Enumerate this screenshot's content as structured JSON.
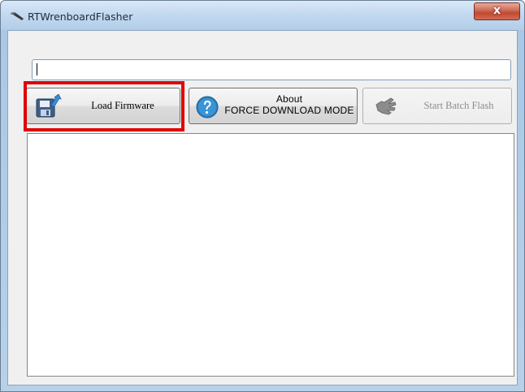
{
  "window": {
    "title": "RTWrenboardFlasher",
    "close_label": "x",
    "app_icon": "app-icon"
  },
  "path_field": {
    "value": "",
    "placeholder": ""
  },
  "buttons": {
    "load_firmware": {
      "label": "Load Firmware",
      "icon": "floppy-disk-icon",
      "highlighted": true
    },
    "about": {
      "label_line1": "About",
      "label_line2": "FORCE DOWNLOAD MODE",
      "icon": "question-icon"
    },
    "start_batch_flash": {
      "label": "Start Batch Flash",
      "icon": "hand-icon",
      "enabled": false
    }
  },
  "colors": {
    "highlight": "#e00000",
    "close_button": "#c04a32",
    "help_icon": "#2b7fc1"
  },
  "log": {
    "text": ""
  }
}
